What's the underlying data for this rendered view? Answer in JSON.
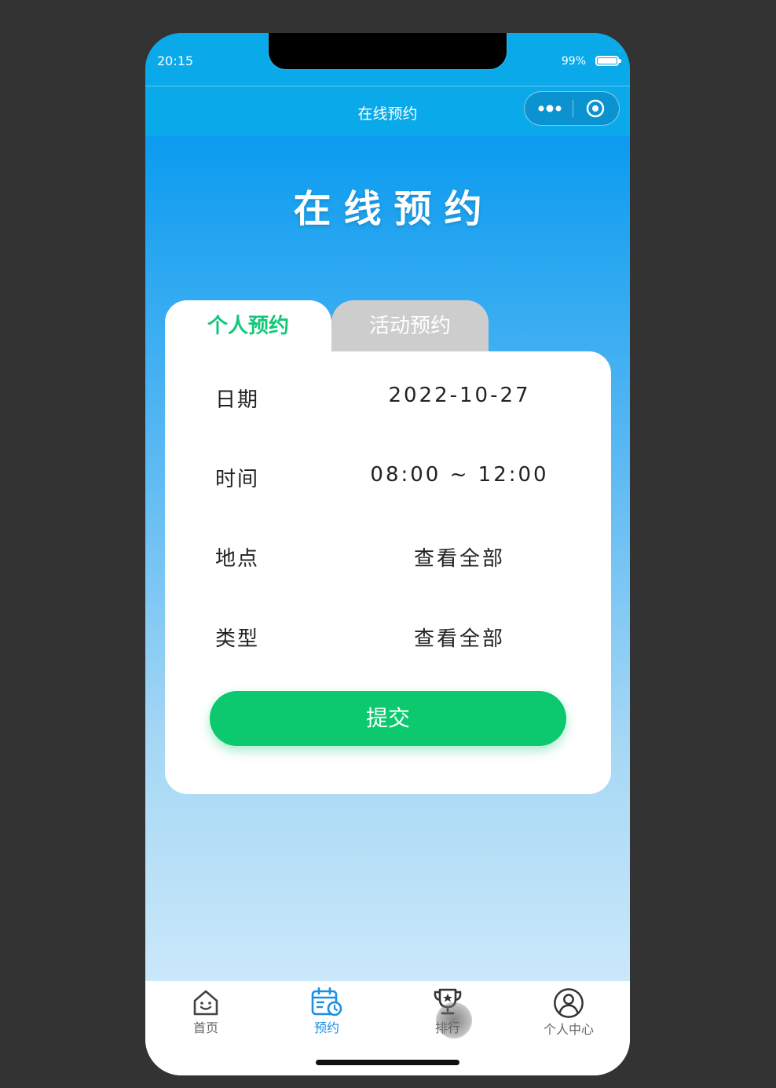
{
  "status": {
    "time": "20:15",
    "battery": "99%"
  },
  "nav": {
    "title": "在线预约"
  },
  "hero": {
    "title": "在线预约"
  },
  "tabs": [
    {
      "label": "个人预约",
      "active": true
    },
    {
      "label": "活动预约",
      "active": false
    }
  ],
  "form": {
    "rows": [
      {
        "label": "日期",
        "value": "2022-10-27"
      },
      {
        "label": "时间",
        "value": "08:00 ~ 12:00"
      },
      {
        "label": "地点",
        "value": "查看全部"
      },
      {
        "label": "类型",
        "value": "查看全部"
      }
    ],
    "submit_label": "提交"
  },
  "tabbar": {
    "items": [
      {
        "label": "首页",
        "icon": "home-icon",
        "active": false
      },
      {
        "label": "预约",
        "icon": "calendar-clock-icon",
        "active": true
      },
      {
        "label": "排行",
        "icon": "trophy-icon",
        "active": false
      },
      {
        "label": "个人中心",
        "icon": "user-icon",
        "active": false
      }
    ]
  },
  "colors": {
    "nav_bg": "#0aaaea",
    "accent_green": "#0cc86f",
    "active_tab_text": "#13c77a",
    "tabbar_active": "#1b8fe3"
  }
}
